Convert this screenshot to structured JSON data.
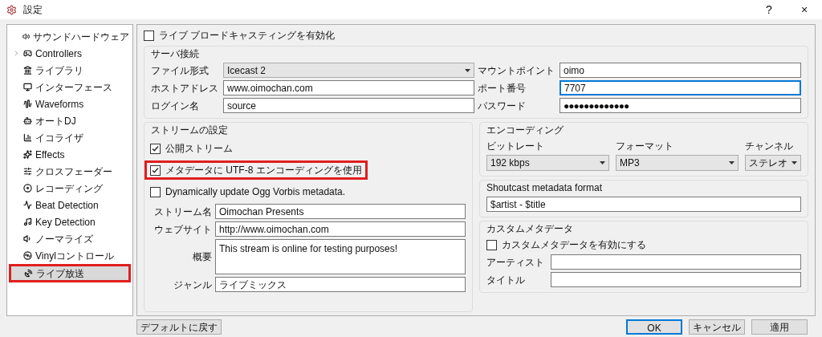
{
  "window": {
    "title": "設定",
    "buttons": [
      "?",
      "×"
    ]
  },
  "sidebar": {
    "items": [
      {
        "label": "サウンドハードウェア",
        "selected": false,
        "expandable": false,
        "highlighted": false
      },
      {
        "label": "Controllers",
        "selected": false,
        "expandable": true,
        "highlighted": false
      },
      {
        "label": "ライブラリ",
        "selected": false,
        "expandable": false,
        "highlighted": false
      },
      {
        "label": "インターフェース",
        "selected": false,
        "expandable": false,
        "highlighted": false
      },
      {
        "label": "Waveforms",
        "selected": false,
        "expandable": false,
        "highlighted": false
      },
      {
        "label": "オートDJ",
        "selected": false,
        "expandable": false,
        "highlighted": false
      },
      {
        "label": "イコライザ",
        "selected": false,
        "expandable": false,
        "highlighted": false
      },
      {
        "label": "Effects",
        "selected": false,
        "expandable": false,
        "highlighted": false
      },
      {
        "label": "クロスフェーダー",
        "selected": false,
        "expandable": false,
        "highlighted": false
      },
      {
        "label": "レコーディング",
        "selected": false,
        "expandable": false,
        "highlighted": false
      },
      {
        "label": "Beat Detection",
        "selected": false,
        "expandable": false,
        "highlighted": false
      },
      {
        "label": "Key Detection",
        "selected": false,
        "expandable": false,
        "highlighted": false
      },
      {
        "label": "ノーマライズ",
        "selected": false,
        "expandable": false,
        "highlighted": false
      },
      {
        "label": "Vinylコントロール",
        "selected": false,
        "expandable": false,
        "highlighted": false
      },
      {
        "label": "ライブ放送",
        "selected": true,
        "expandable": false,
        "highlighted": true
      }
    ]
  },
  "broadcast_toggle": {
    "label": "ライブ ブロードキャスティングを有効化",
    "checked": false
  },
  "server_connection": {
    "title": "サーバ接続",
    "left_fields": [
      {
        "label": "ファイル形式",
        "value": "Icecast 2",
        "kind": "select"
      },
      {
        "label": "ホストアドレス",
        "value": "www.oimochan.com",
        "kind": "text",
        "focused": false
      },
      {
        "label": "ログイン名",
        "value": "source",
        "kind": "text",
        "focused": false
      }
    ],
    "right_fields": [
      {
        "label": "マウントポイント",
        "value": "oimo",
        "kind": "text",
        "focused": false
      },
      {
        "label": "ポート番号",
        "value": "7707",
        "kind": "text",
        "focused": true
      },
      {
        "label": "パスワード",
        "value": "●●●●●●●●●●●●●",
        "kind": "password",
        "focused": false
      }
    ]
  },
  "stream_settings": {
    "title": "ストリームの設定",
    "checkboxes": [
      {
        "label": "公開ストリーム",
        "checked": true,
        "highlighted": false
      },
      {
        "label": "メタデータに UTF-8 エンコーディングを使用",
        "checked": true,
        "highlighted": true
      },
      {
        "label": "Dynamically update Ogg Vorbis metadata.",
        "checked": false,
        "highlighted": false
      }
    ],
    "fields": [
      {
        "label": "ストリーム名",
        "value": "Oimochan Presents",
        "kind": "text"
      },
      {
        "label": "ウェブサイト",
        "value": "http://www.oimochan.com",
        "kind": "text"
      },
      {
        "label": "概要",
        "value": "This stream is online for testing purposes!",
        "kind": "textarea"
      },
      {
        "label": "ジャンル",
        "value": "ライブミックス",
        "kind": "text"
      }
    ]
  },
  "encoding": {
    "title": "エンコーディング",
    "selects": [
      {
        "label": "ビットレート",
        "value": "192 kbps"
      },
      {
        "label": "フォーマット",
        "value": "MP3"
      },
      {
        "label": "チャンネル",
        "value": "ステレオ"
      }
    ]
  },
  "shoutcast": {
    "title": "Shoutcast metadata format",
    "value": "$artist - $title"
  },
  "custom_metadata": {
    "title": "カスタムメタデータ",
    "checkbox": {
      "label": "カスタムメタデータを有効にする",
      "checked": false
    },
    "fields": [
      {
        "label": "アーティスト"
      },
      {
        "label": "タイトル"
      }
    ]
  },
  "footer": {
    "reset_button": "デフォルトに戻す",
    "buttons": [
      {
        "label": "OK",
        "default": true
      },
      {
        "label": "キャンセル",
        "default": false
      },
      {
        "label": "適用",
        "default": false
      }
    ]
  }
}
